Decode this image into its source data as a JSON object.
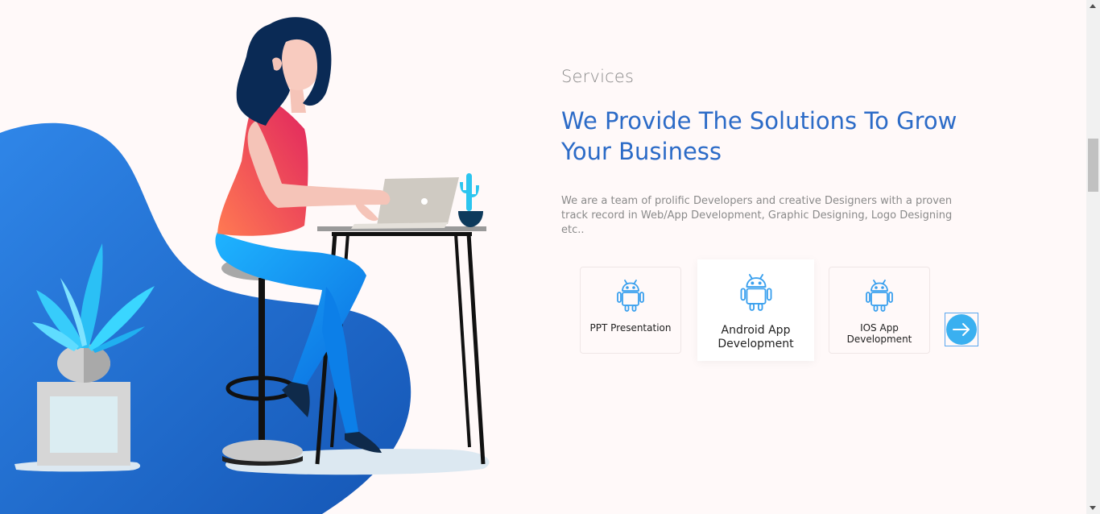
{
  "services": {
    "subtitle": "Services",
    "headline": "We Provide The Solutions To Grow Your Business",
    "description": "We are a team of prolific Developers and creative Designers with a proven track record in Web/App Development, Graphic Designing, Logo Designing etc..",
    "cards": [
      {
        "label": "PPT Presentation",
        "icon": "android-icon"
      },
      {
        "label": "Android App Development",
        "icon": "android-icon"
      },
      {
        "label": "IOS App Development",
        "icon": "android-icon"
      }
    ],
    "next_icon": "arrow-right-icon"
  },
  "colors": {
    "accent": "#2c6bc7",
    "icon": "#3aa0ee",
    "next_button": "#3ab0f0",
    "background": "#fff9f9"
  }
}
